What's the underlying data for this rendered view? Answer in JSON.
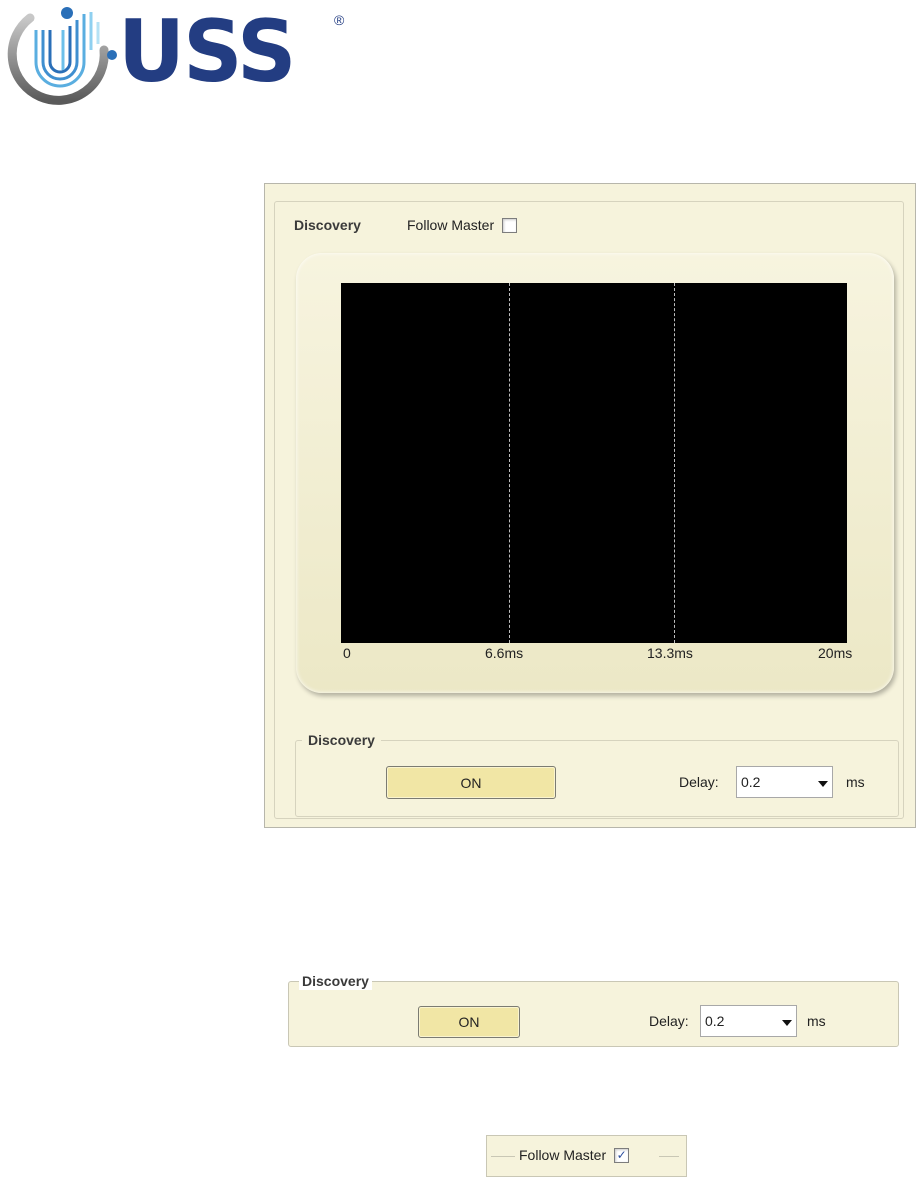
{
  "logo": {
    "text": "USS",
    "registered": "®"
  },
  "panel_full": {
    "group_title": "Discovery",
    "follow_master": {
      "label": "Follow Master",
      "checked": false
    },
    "scope": {
      "ticks": [
        "0",
        "6.6ms",
        "13.3ms",
        "20ms"
      ]
    },
    "discovery_group": {
      "title": "Discovery",
      "on_button": "ON",
      "delay_label": "Delay:",
      "delay_value": "0.2",
      "delay_unit": "ms"
    }
  },
  "panel_discovery": {
    "title": "Discovery",
    "on_button": "ON",
    "delay_label": "Delay:",
    "delay_value": "0.2",
    "delay_unit": "ms"
  },
  "panel_follow": {
    "label": "Follow Master",
    "checked": true,
    "check_mark": "✓"
  },
  "colors": {
    "panel_bg": "#f6f3dc",
    "button_bg": "#f1e6a5",
    "logo_blue": "#233d82",
    "scope_bg": "#000000"
  }
}
